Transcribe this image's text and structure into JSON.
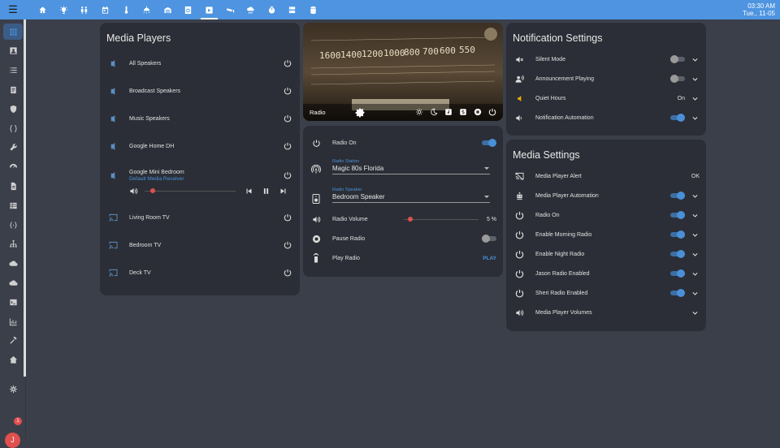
{
  "header": {
    "time": "03:30 AM",
    "date": "Tue., 11-05",
    "tabs": [
      "home-icon",
      "lightbulb-icon",
      "people-icon",
      "calendar-icon",
      "thermometer-icon",
      "ceiling-light-icon",
      "garage-icon",
      "washer-icon",
      "media-icon",
      "cctv-icon",
      "weather-icon",
      "robot-vacuum-icon",
      "server-icon",
      "database-icon"
    ],
    "active_tab": 8
  },
  "sidebar": {
    "items": [
      "grid-icon",
      "account-box-icon",
      "list-icon",
      "clipboard-icon",
      "shield-icon",
      "code-braces-icon",
      "wrench-icon",
      "gauge-icon",
      "file-icon",
      "table-icon",
      "json-icon",
      "hierarchy-icon",
      "cloud-download-icon",
      "cloud-icon",
      "terminal-icon",
      "chart-icon",
      "hammer-icon",
      "home-assistant-icon",
      "settings-icon"
    ],
    "notification_count": "1",
    "avatar_letter": "J"
  },
  "media_players": {
    "title": "Media Players",
    "items": [
      {
        "name": "All Speakers",
        "icon": "speaker-icon"
      },
      {
        "name": "Broadcast Speakers",
        "icon": "speaker-icon"
      },
      {
        "name": "Music Speakers",
        "icon": "speaker-icon"
      },
      {
        "name": "Google Home DH",
        "icon": "speaker-icon"
      },
      {
        "name": "Google Mini Bedroom",
        "subtitle": "Default Media Receiver",
        "icon": "speaker-icon"
      },
      {
        "name": "Living Room TV",
        "icon": "cast-icon"
      },
      {
        "name": "Bedroom TV",
        "icon": "cast-icon"
      },
      {
        "name": "Deck TV",
        "icon": "cast-icon"
      }
    ],
    "volume_level": 0.06
  },
  "radio": {
    "hero_label": "Radio",
    "hero_buttons": [
      "brightness-icon",
      "moon-icon",
      "music-note-icon",
      "s-box-icon",
      "stop-icon",
      "power-icon"
    ],
    "radio_on_label": "Radio On",
    "radio_on": true,
    "station_label": "Radio Station",
    "station_value": "Magic 80s Florida",
    "speaker_label": "Radio Speaker",
    "speaker_value": "Bedroom Speaker",
    "volume_label": "Radio Volume",
    "volume_value": "5 %",
    "volume_level": 0.05,
    "pause_label": "Pause Radio",
    "pause_on": false,
    "play_label": "Play Radio",
    "play_action": "PLAY"
  },
  "notification_settings": {
    "title": "Notification Settings",
    "rows": [
      {
        "label": "Silent Mode",
        "icon": "bell-off-icon",
        "control": "toggle",
        "on": false
      },
      {
        "label": "Announcement Playing",
        "icon": "account-voice-icon",
        "control": "toggle",
        "on": false
      },
      {
        "label": "Quiet Hours",
        "icon": "volume-low-icon",
        "control": "value",
        "value": "On",
        "icon_color": "#f0b000"
      },
      {
        "label": "Notification Automation",
        "icon": "volume-icon",
        "control": "toggle",
        "on": true
      }
    ]
  },
  "media_settings": {
    "title": "Media Settings",
    "rows": [
      {
        "label": "Media Player Alert",
        "icon": "cast-off-icon",
        "control": "value",
        "value": "OK"
      },
      {
        "label": "Media Player Automation",
        "icon": "robot-icon",
        "control": "toggle",
        "on": true
      },
      {
        "label": "Radio On",
        "icon": "power-icon",
        "control": "toggle",
        "on": true
      },
      {
        "label": "Enable Morning Radio",
        "icon": "power-icon",
        "control": "toggle",
        "on": true
      },
      {
        "label": "Enable Night Radio",
        "icon": "power-icon",
        "control": "toggle",
        "on": true
      },
      {
        "label": "Jason Radio Enabled",
        "icon": "power-icon",
        "control": "toggle",
        "on": true
      },
      {
        "label": "Sheri Radio Enabled",
        "icon": "power-icon",
        "control": "toggle",
        "on": true
      },
      {
        "label": "Media Player Volumes",
        "icon": "volume-high-icon",
        "control": "none"
      }
    ]
  },
  "colors": {
    "accent": "#4a90d9",
    "header": "#4e94e0",
    "card": "#2b2e36",
    "background": "#3a3f4a",
    "alert": "#e0504e"
  }
}
